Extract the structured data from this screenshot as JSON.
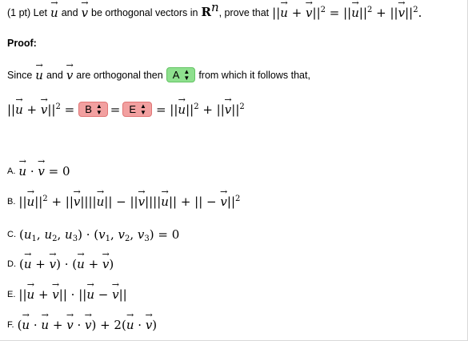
{
  "question": {
    "points": "(1 pt) Let",
    "and": "and",
    "be_orthogonal": "be orthogonal vectors in",
    "space": "R",
    "space_exp": "n",
    "prove_that": ", prove that",
    "u": "u",
    "v": "v"
  },
  "proof_label": "Proof:",
  "since": {
    "since": "Since",
    "and": "and",
    "are_orthogonal": "are orthogonal then",
    "select_value": "A",
    "follows": "from which it follows that,"
  },
  "equation": {
    "select1_value": "B",
    "select2_value": "E"
  },
  "options": [
    {
      "letter": "A."
    },
    {
      "letter": "B."
    },
    {
      "letter": "C."
    },
    {
      "letter": "D."
    },
    {
      "letter": "E."
    },
    {
      "letter": "F."
    }
  ],
  "colors": {
    "correct_select": "#8ee08e",
    "incorrect_select": "#f2a0a0"
  }
}
